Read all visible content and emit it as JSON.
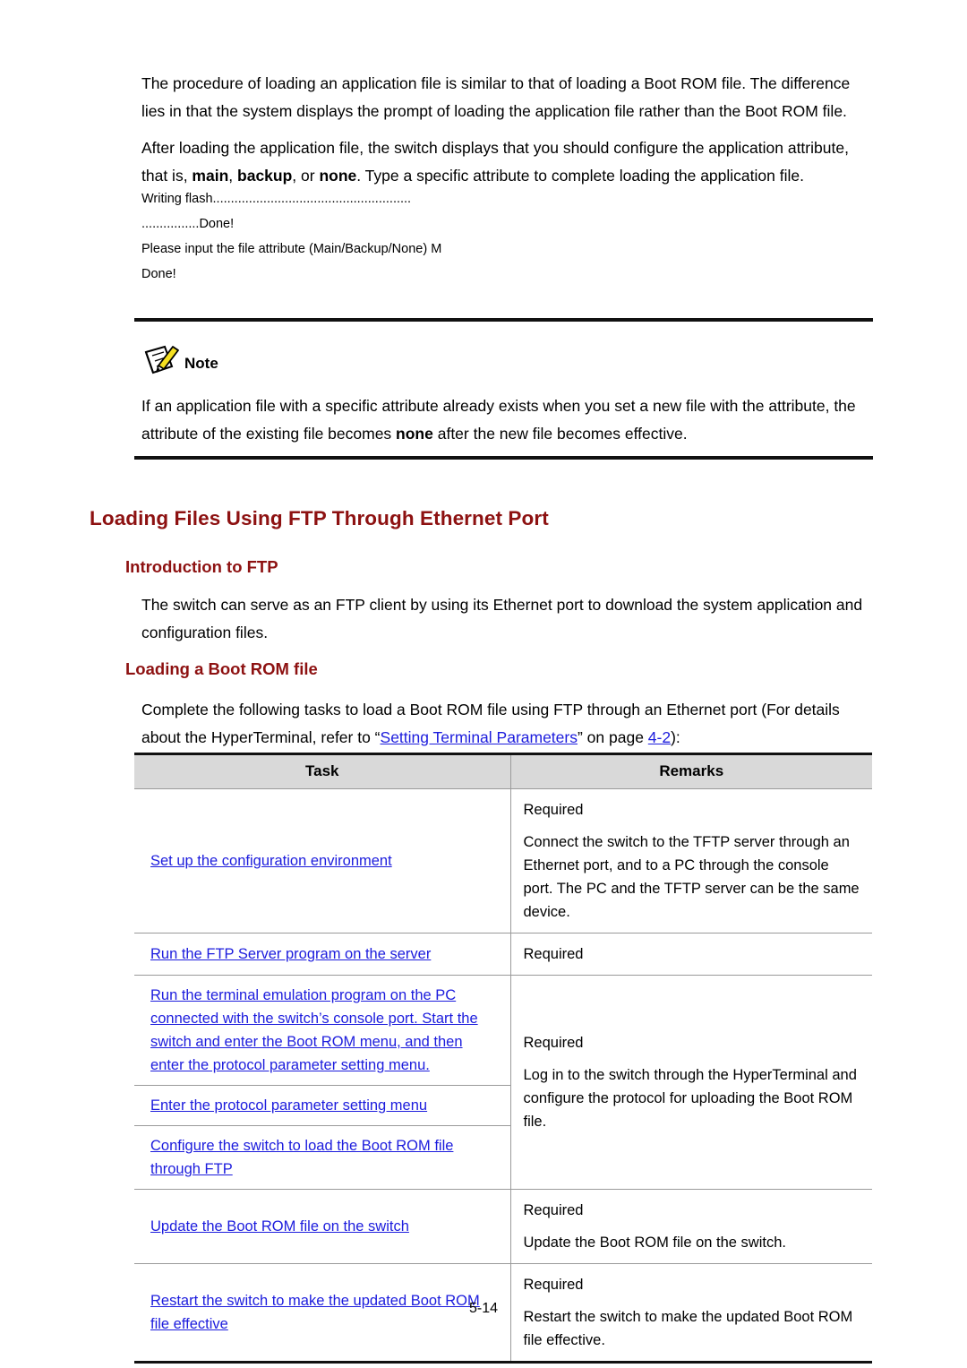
{
  "document": {
    "intro_paragraphs": [
      {
        "id": "p1",
        "runs": [
          {
            "text": "The procedure of loading an application file is similar to that of loading a Boot ROM file. The difference lies in that the system displays the prompt of loading the application file rather than the Boot ROM file.",
            "bold": false
          }
        ]
      },
      {
        "id": "p2",
        "runs": [
          {
            "text": "After loading the application file, the switch displays that you should configure the application attribute, that is, ",
            "bold": false
          },
          {
            "text": "main",
            "bold": true
          },
          {
            "text": ", ",
            "bold": false
          },
          {
            "text": "backup",
            "bold": true
          },
          {
            "text": ", or ",
            "bold": false
          },
          {
            "text": "none",
            "bold": true
          },
          {
            "text": ". Type a specific attribute to complete loading the application file.",
            "bold": false
          }
        ]
      }
    ],
    "console_output": [
      "Writing flash.......................................................",
      "................Done!",
      "Please input the file attribute (Main/Backup/None) M",
      "Done!"
    ],
    "note": {
      "icon": "note-pencil-icon",
      "label": "Note",
      "runs": [
        {
          "text": "If an application file with a specific attribute already exists when you set a new file with the attribute, the attribute of the existing file becomes ",
          "bold": false
        },
        {
          "text": "none",
          "bold": true
        },
        {
          "text": " after the new file becomes effective.",
          "bold": false
        }
      ]
    },
    "section": {
      "heading1": "Loading Files Using FTP Through Ethernet Port",
      "subsection_a": {
        "heading2": "Introduction to FTP",
        "body": "The switch can serve as an FTP client by using its Ethernet port to download the system application and configuration files."
      },
      "subsection_b": {
        "heading2": "Loading a Boot ROM file",
        "body_runs": [
          {
            "text": "Complete the following tasks to load a Boot ROM file using FTP through an Ethernet port (For details about the HyperTerminal, refer to “",
            "link": false
          },
          {
            "text": "Setting Terminal Parameters",
            "link": true
          },
          {
            "text": "” on page ",
            "link": false
          },
          {
            "text": "4-2",
            "link": true
          },
          {
            "text": "):",
            "link": false
          }
        ]
      }
    },
    "table": {
      "headers": [
        "Task",
        "Remarks"
      ],
      "rows": [
        {
          "task": "Set up the configuration environment",
          "task_is_link": true,
          "remarks": [
            "Required",
            "Connect the switch to the TFTP server through an Ethernet port, and to a PC through the console port. The PC and the TFTP server can be the same device."
          ]
        },
        {
          "task": "Run the FTP Server program on the server",
          "task_is_link": true,
          "remarks": [
            "Required"
          ]
        },
        {
          "task": "Run the terminal emulation program on the PC connected with the switch’s console port. Start the switch and enter the Boot ROM menu, and then enter the protocol parameter setting menu.",
          "task_is_link": true,
          "remarks": [
            "Required",
            "Log in to the switch through the HyperTerminal and configure the protocol for uploading the Boot ROM file."
          ]
        },
        {
          "task": "Enter the protocol parameter setting menu",
          "task_is_link": true,
          "remarks": []
        },
        {
          "task": "Configure the switch to load the Boot ROM file through FTP",
          "task_is_link": true,
          "remarks": []
        },
        {
          "task": "Update the Boot ROM file on the switch",
          "task_is_link": true,
          "remarks": [
            "Required",
            "Update the Boot ROM file on the switch."
          ]
        },
        {
          "task": "Restart the switch to make the updated Boot ROM file effective",
          "task_is_link": true,
          "remarks": [
            "Required",
            "Restart the switch to make the updated Boot ROM file effective."
          ]
        }
      ]
    },
    "footer": {
      "page_number": "5-14"
    },
    "colors": {
      "heading": "#8d1111",
      "link": "#1c1cdd",
      "table_header_bg": "#d9d9d9",
      "rule": "#111111",
      "pencil": "#f5e020"
    }
  }
}
